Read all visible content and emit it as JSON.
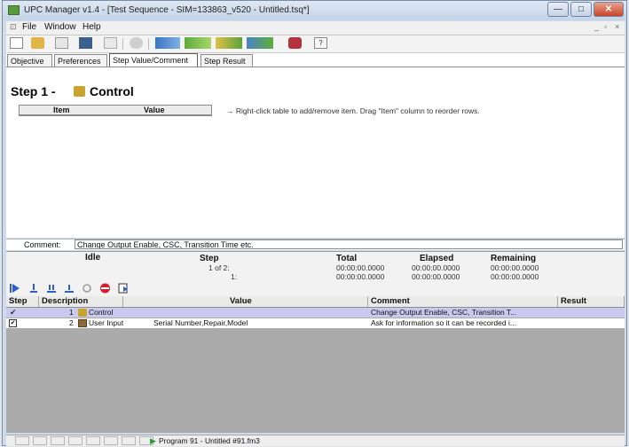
{
  "window": {
    "title": "UPC Manager v1.4 - [Test Sequence - SIM=133863_v520 - Untitled.tsq*]",
    "minimize": "—",
    "maximize": "□",
    "close": "✕"
  },
  "menu": {
    "items": [
      "File",
      "Window",
      "Help"
    ]
  },
  "tabs": [
    "Objective",
    "Preferences",
    "Step Value/Comment",
    "Step Result"
  ],
  "step": {
    "title": "Step 1 -",
    "name": "Control"
  },
  "items_table": {
    "col_item": "Item",
    "col_value": "Value"
  },
  "hint": "→ Right-click table to add/remove item. Drag \"Item\" column to reorder rows.",
  "comment": {
    "label": "Comment:",
    "value": "Change Output Enable, CSC, Transition Time etc."
  },
  "status": {
    "state": "Idle",
    "step_label": "Step",
    "step_of": "1 of 2:",
    "step_sub": "1:",
    "total_label": "Total",
    "total_1": "00:00:00.0000",
    "total_2": "00:00:00.0000",
    "elapsed_label": "Elapsed",
    "elapsed_1": "00:00:00.0000",
    "elapsed_2": "00:00:00.0000",
    "remaining_label": "Remaining",
    "remaining_1": "00:00:00.0000",
    "remaining_2": "00:00:00.0000"
  },
  "grid": {
    "headers": [
      "Step",
      "Description",
      "Value",
      "Comment",
      "Result"
    ],
    "rows": [
      {
        "step": "1",
        "description": "Control",
        "value": "",
        "comment": "Change Output Enable, CSC, Transition T...",
        "result": ""
      },
      {
        "step": "2",
        "description": "User Input",
        "value": "Serial Number,Repair,Model",
        "comment": "Ask for information so it can be recorded i...",
        "result": ""
      }
    ]
  },
  "statusbar": {
    "program": "Program 91 - Untitled #91.fm3"
  },
  "colors": {
    "selected_row": "#c9c9ee",
    "grid_bg": "#ababab",
    "title_gradient": "#c3d3e6"
  }
}
